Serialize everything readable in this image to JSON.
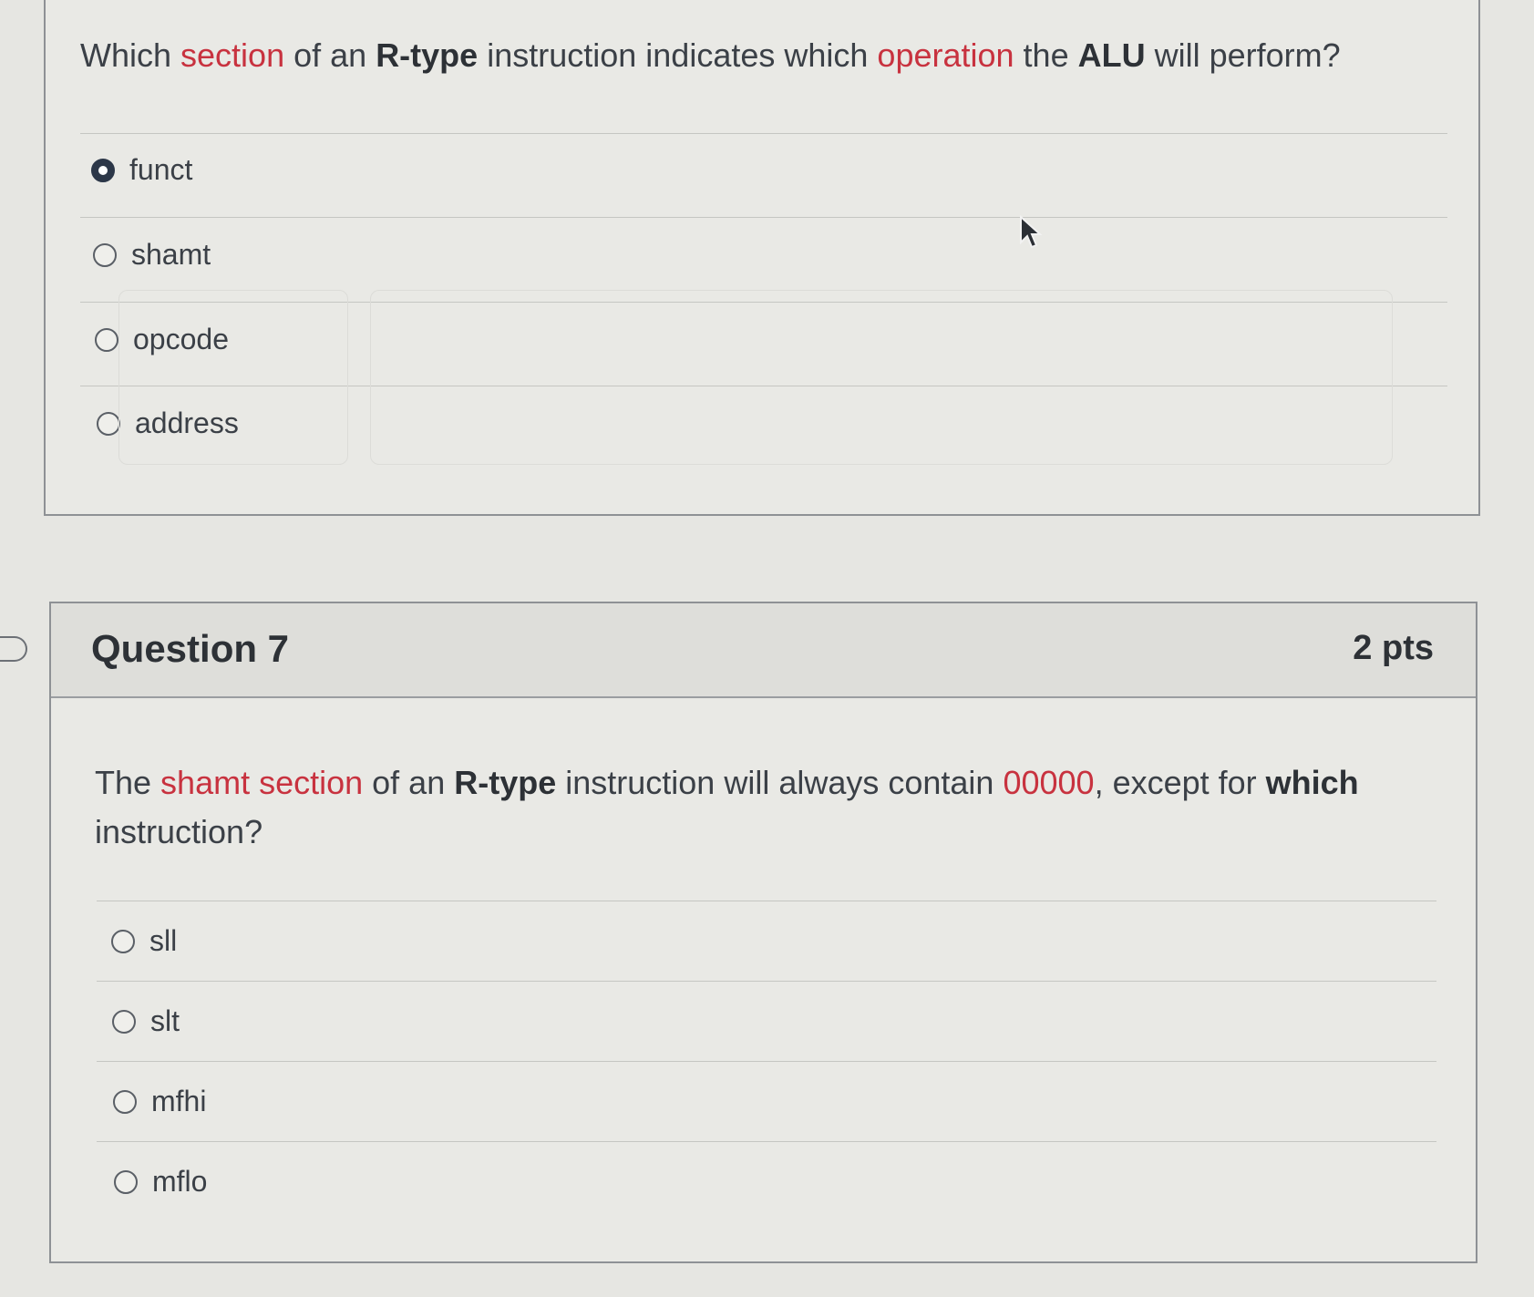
{
  "question6": {
    "text_parts": [
      {
        "t": "Which ",
        "style": "plain"
      },
      {
        "t": "section",
        "style": "red"
      },
      {
        "t": " of an ",
        "style": "plain"
      },
      {
        "t": "R-type",
        "style": "bold"
      },
      {
        "t": " instruction indicates which ",
        "style": "plain"
      },
      {
        "t": "operation",
        "style": "red"
      },
      {
        "t": " the ",
        "style": "plain"
      },
      {
        "t": "ALU",
        "style": "bold"
      },
      {
        "t": " will perform?",
        "style": "plain"
      }
    ],
    "answers": [
      {
        "label": "funct",
        "selected": true
      },
      {
        "label": "shamt",
        "selected": false
      },
      {
        "label": "opcode",
        "selected": false
      },
      {
        "label": "address",
        "selected": false
      }
    ]
  },
  "question7": {
    "title": "Question 7",
    "points": "2 pts",
    "text_parts": [
      {
        "t": "The ",
        "style": "plain"
      },
      {
        "t": "shamt section",
        "style": "red"
      },
      {
        "t": " of an ",
        "style": "plain"
      },
      {
        "t": "R-type",
        "style": "bold"
      },
      {
        "t": " instruction will always contain ",
        "style": "plain"
      },
      {
        "t": "00000",
        "style": "red"
      },
      {
        "t": ", except for ",
        "style": "plain"
      },
      {
        "t": "which",
        "style": "bold"
      },
      {
        "t": " instruction?",
        "style": "plain"
      }
    ],
    "answers": [
      {
        "label": "sll",
        "selected": false
      },
      {
        "label": "slt",
        "selected": false
      },
      {
        "label": "mfhi",
        "selected": false
      },
      {
        "label": "mflo",
        "selected": false
      }
    ]
  },
  "colors": {
    "accent_red": "#c8323f",
    "selected_radio": "#2c3748",
    "text": "#3b4047"
  }
}
